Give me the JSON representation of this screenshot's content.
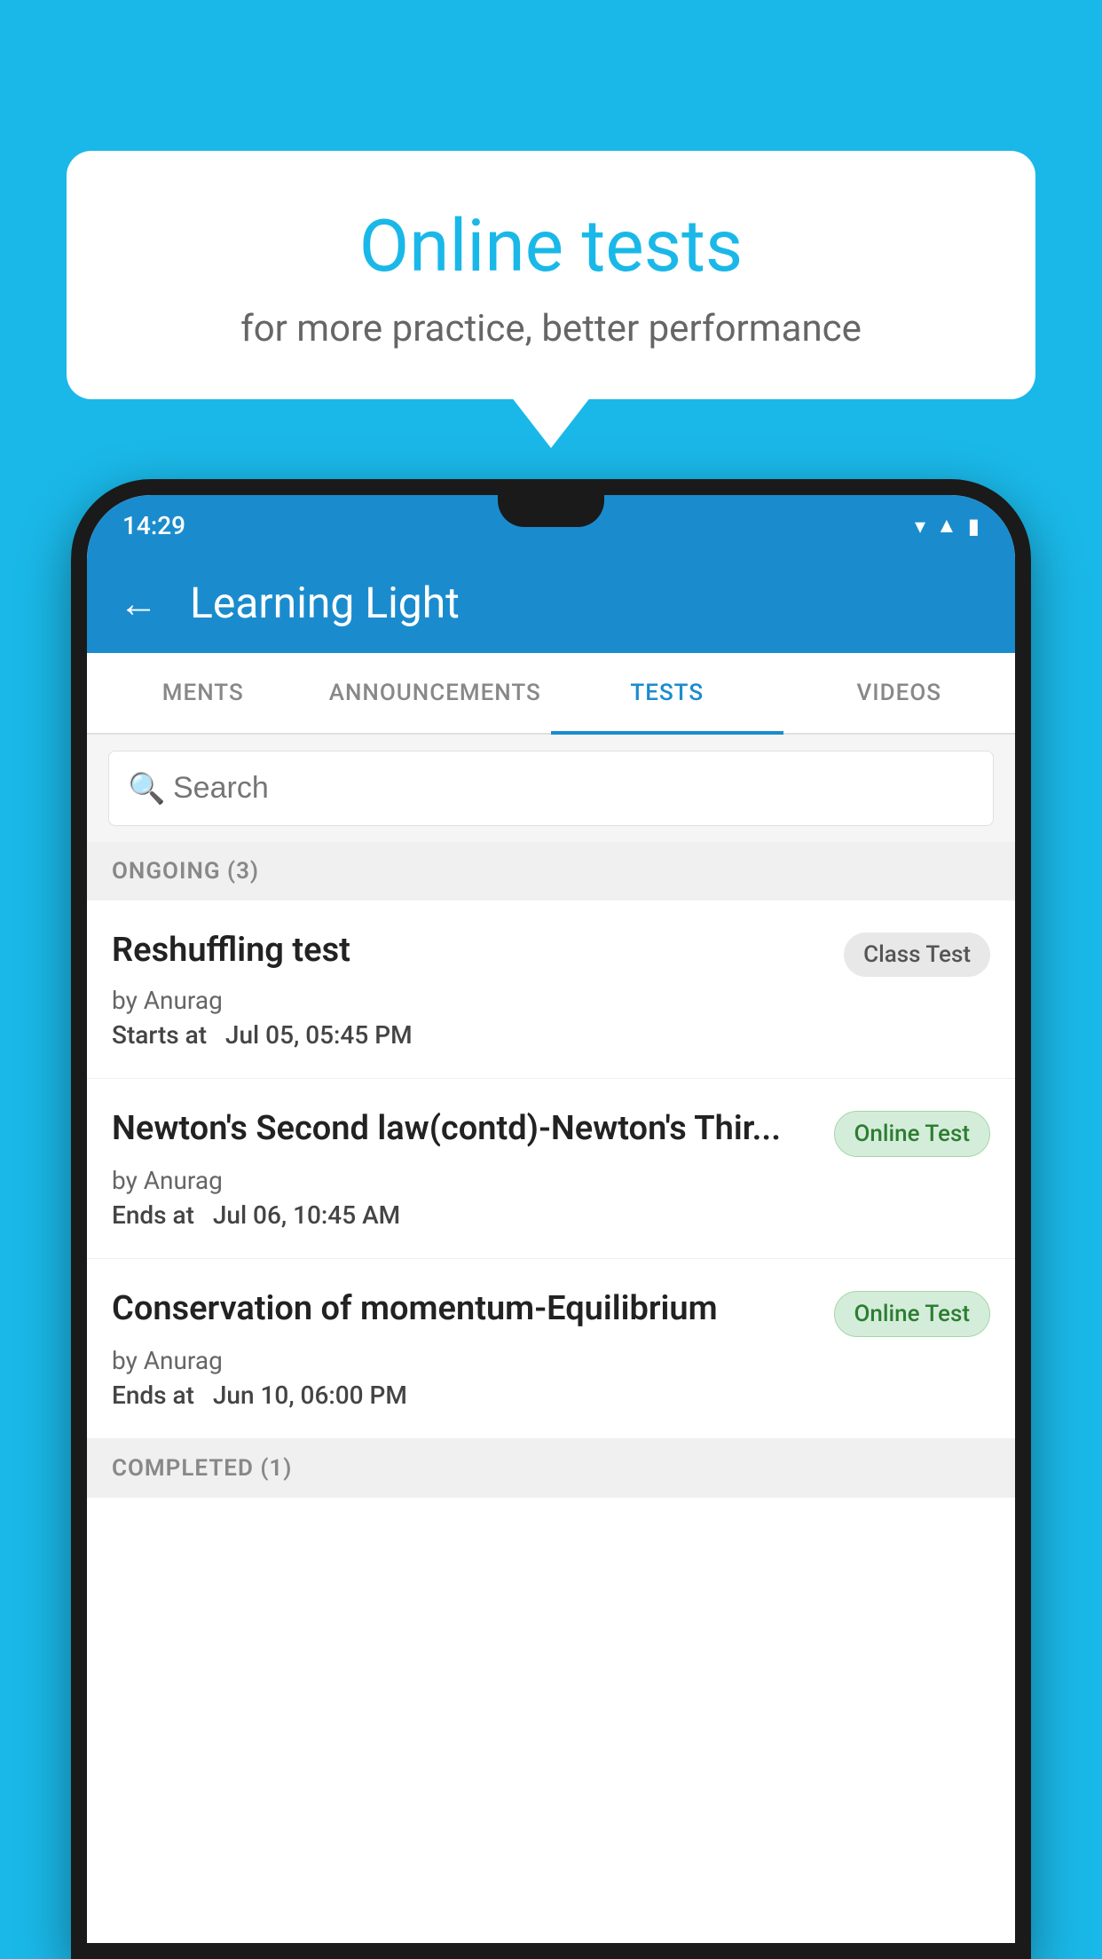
{
  "background_color": "#1ab8e8",
  "speech_bubble": {
    "title": "Online tests",
    "subtitle": "for more practice, better performance"
  },
  "phone": {
    "status_bar": {
      "time": "14:29",
      "icons": [
        "wifi",
        "signal",
        "battery"
      ]
    },
    "app_bar": {
      "title": "Learning Light",
      "back_label": "←"
    },
    "tabs": [
      {
        "label": "MENTS",
        "active": false
      },
      {
        "label": "ANNOUNCEMENTS",
        "active": false
      },
      {
        "label": "TESTS",
        "active": true
      },
      {
        "label": "VIDEOS",
        "active": false
      }
    ],
    "search": {
      "placeholder": "Search"
    },
    "ongoing_section": {
      "label": "ONGOING (3)"
    },
    "tests": [
      {
        "name": "Reshuffling test",
        "badge": "Class Test",
        "badge_type": "class",
        "author": "by Anurag",
        "date_label": "Starts at",
        "date": "Jul 05, 05:45 PM"
      },
      {
        "name": "Newton's Second law(contd)-Newton's Thir...",
        "badge": "Online Test",
        "badge_type": "online",
        "author": "by Anurag",
        "date_label": "Ends at",
        "date": "Jul 06, 10:45 AM"
      },
      {
        "name": "Conservation of momentum-Equilibrium",
        "badge": "Online Test",
        "badge_type": "online",
        "author": "by Anurag",
        "date_label": "Ends at",
        "date": "Jun 10, 06:00 PM"
      }
    ],
    "completed_section": {
      "label": "COMPLETED (1)"
    }
  }
}
